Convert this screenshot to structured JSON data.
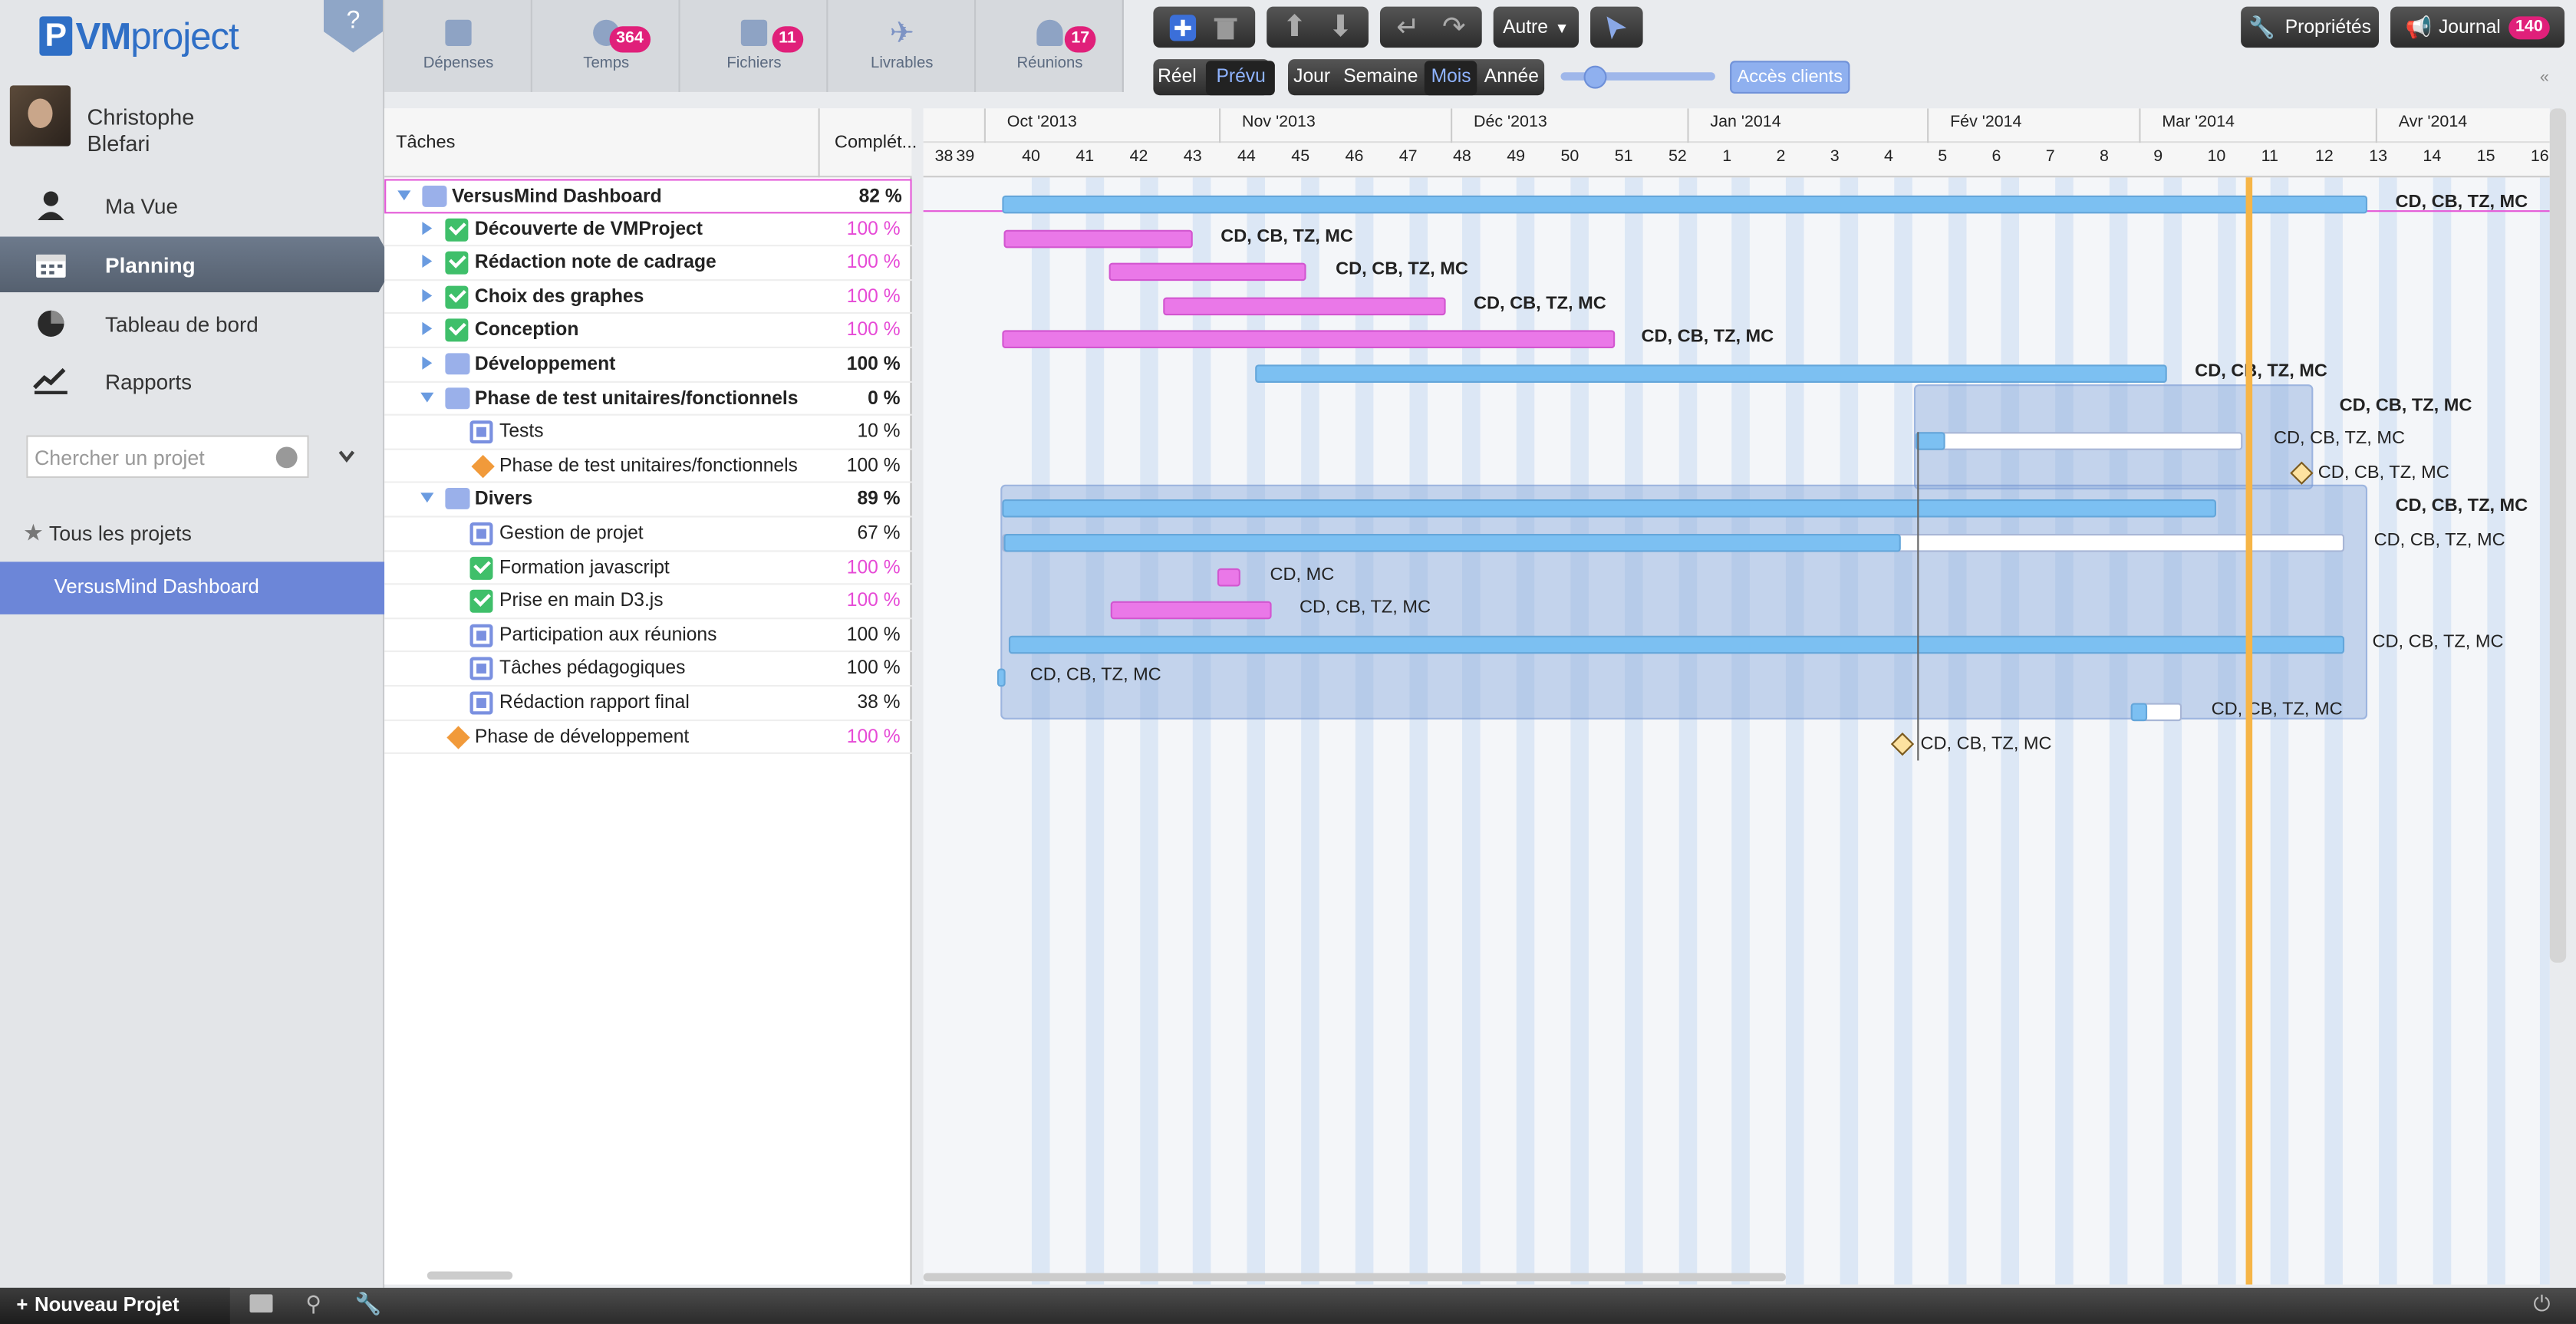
{
  "app": {
    "logo_letter": "P",
    "logo_bold": "VM",
    "logo_rest": "project",
    "help": "?"
  },
  "user": {
    "first": "Christophe",
    "last": "Blefari"
  },
  "nav": [
    {
      "label": "Ma Vue",
      "icon": "person-icon"
    },
    {
      "label": "Planning",
      "icon": "calendar-icon"
    },
    {
      "label": "Tableau de bord",
      "icon": "pie-chart-icon"
    },
    {
      "label": "Rapports",
      "icon": "trend-chart-icon"
    }
  ],
  "search": {
    "placeholder": "Chercher un projet"
  },
  "projects": {
    "all_label": "Tous les projets",
    "selected": "VersusMind Dashboard"
  },
  "topnav": [
    {
      "label": "Dépenses",
      "badge": ""
    },
    {
      "label": "Temps",
      "badge": "364"
    },
    {
      "label": "Fichiers",
      "badge": "11"
    },
    {
      "label": "Livrables",
      "badge": ""
    },
    {
      "label": "Réunions",
      "badge": "17"
    }
  ],
  "toolbar": {
    "other": "Autre",
    "view_real": "Réel",
    "view_planned": "Prévu",
    "scale_day": "Jour",
    "scale_week": "Semaine",
    "scale_month": "Mois",
    "scale_year": "Année",
    "client_access": "Accès clients",
    "properties": "Propriétés",
    "journal": "Journal",
    "journal_count": "140"
  },
  "grid": {
    "col_tasks": "Tâches",
    "col_completion": "Complét..."
  },
  "tasks": [
    {
      "name": "VersusMind Dashboard",
      "pct": "82 %"
    },
    {
      "name": "Découverte de VMProject",
      "pct": "100 %"
    },
    {
      "name": "Rédaction note de cadrage",
      "pct": "100 %"
    },
    {
      "name": "Choix des graphes",
      "pct": "100 %"
    },
    {
      "name": "Conception",
      "pct": "100 %"
    },
    {
      "name": "Développement",
      "pct": "100 %"
    },
    {
      "name": "Phase de test unitaires/fonctionnels",
      "pct": "0 %"
    },
    {
      "name": "Tests",
      "pct": "10 %"
    },
    {
      "name": "Phase de test unitaires/fonctionnels",
      "pct": "100 %"
    },
    {
      "name": "Divers",
      "pct": "89 %"
    },
    {
      "name": "Gestion de projet",
      "pct": "67 %"
    },
    {
      "name": "Formation javascript",
      "pct": "100 %"
    },
    {
      "name": "Prise en main D3.js",
      "pct": "100 %"
    },
    {
      "name": "Participation aux réunions",
      "pct": "100 %"
    },
    {
      "name": "Tâches pédagogiques",
      "pct": "100 %"
    },
    {
      "name": "Rédaction rapport final",
      "pct": "38 %"
    },
    {
      "name": "Phase de développement",
      "pct": "100 %"
    }
  ],
  "gantt": {
    "months": [
      "Oct '2013",
      "Nov '2013",
      "Déc '2013",
      "Jan '2014",
      "Fév '2014",
      "Mar '2014",
      "Avr '2014"
    ],
    "weeks": [
      "38",
      "39",
      "40",
      "41",
      "42",
      "43",
      "44",
      "45",
      "46",
      "47",
      "48",
      "49",
      "50",
      "51",
      "52",
      "1",
      "2",
      "3",
      "4",
      "5",
      "6",
      "7",
      "8",
      "9",
      "10",
      "11",
      "12",
      "13",
      "14",
      "15",
      "16"
    ],
    "labels": [
      "CD, CB, TZ, MC",
      "CD, CB, TZ, MC",
      "CD, CB, TZ, MC",
      "CD, CB, TZ, MC",
      "CD, CB, TZ, MC",
      "CD, CB, TZ, MC",
      "CD, CB, TZ, MC",
      "CD, CB, TZ, MC",
      "CD, CB, TZ, MC",
      "CD, CB, TZ, MC",
      "CD, CB, TZ, MC",
      "CD, MC",
      "CD, CB, TZ, MC",
      "CD, CB, TZ, MC",
      "CD, CB, TZ, MC",
      "CD, CB, TZ, MC",
      "CD, CB, TZ, MC"
    ]
  },
  "bottom": {
    "new_project": "Nouveau Projet"
  }
}
